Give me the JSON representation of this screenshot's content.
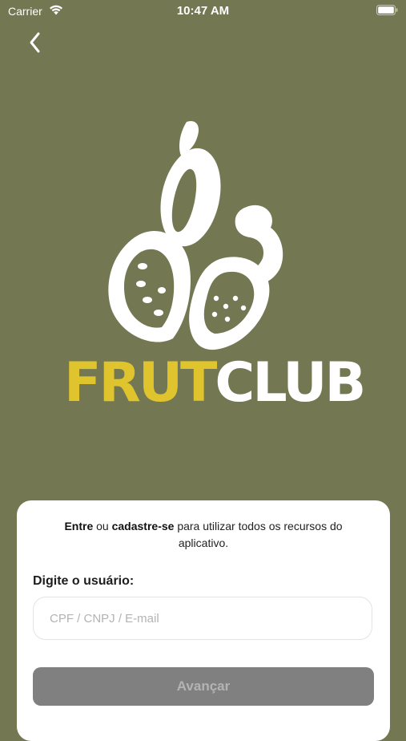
{
  "status_bar": {
    "carrier": "Carrier",
    "time": "10:47 AM",
    "icons": [
      "wifi-icon",
      "battery-icon"
    ]
  },
  "nav": {
    "back_icon": "chevron-left-icon"
  },
  "brand": {
    "name_part1": "FRUT",
    "name_part2": "CLUB",
    "colors": {
      "frut": "#dfc42d",
      "club": "#ffffff",
      "background": "#737752"
    }
  },
  "login": {
    "intro_bold1": "Entre",
    "intro_text1": " ou ",
    "intro_bold2": "cadastre-se",
    "intro_text2": " para utilizar todos os recursos do aplicativo.",
    "user_label": "Digite o usuário:",
    "user_placeholder": "CPF / CNPJ / E-mail",
    "user_value": "",
    "next_button": "Avançar"
  }
}
